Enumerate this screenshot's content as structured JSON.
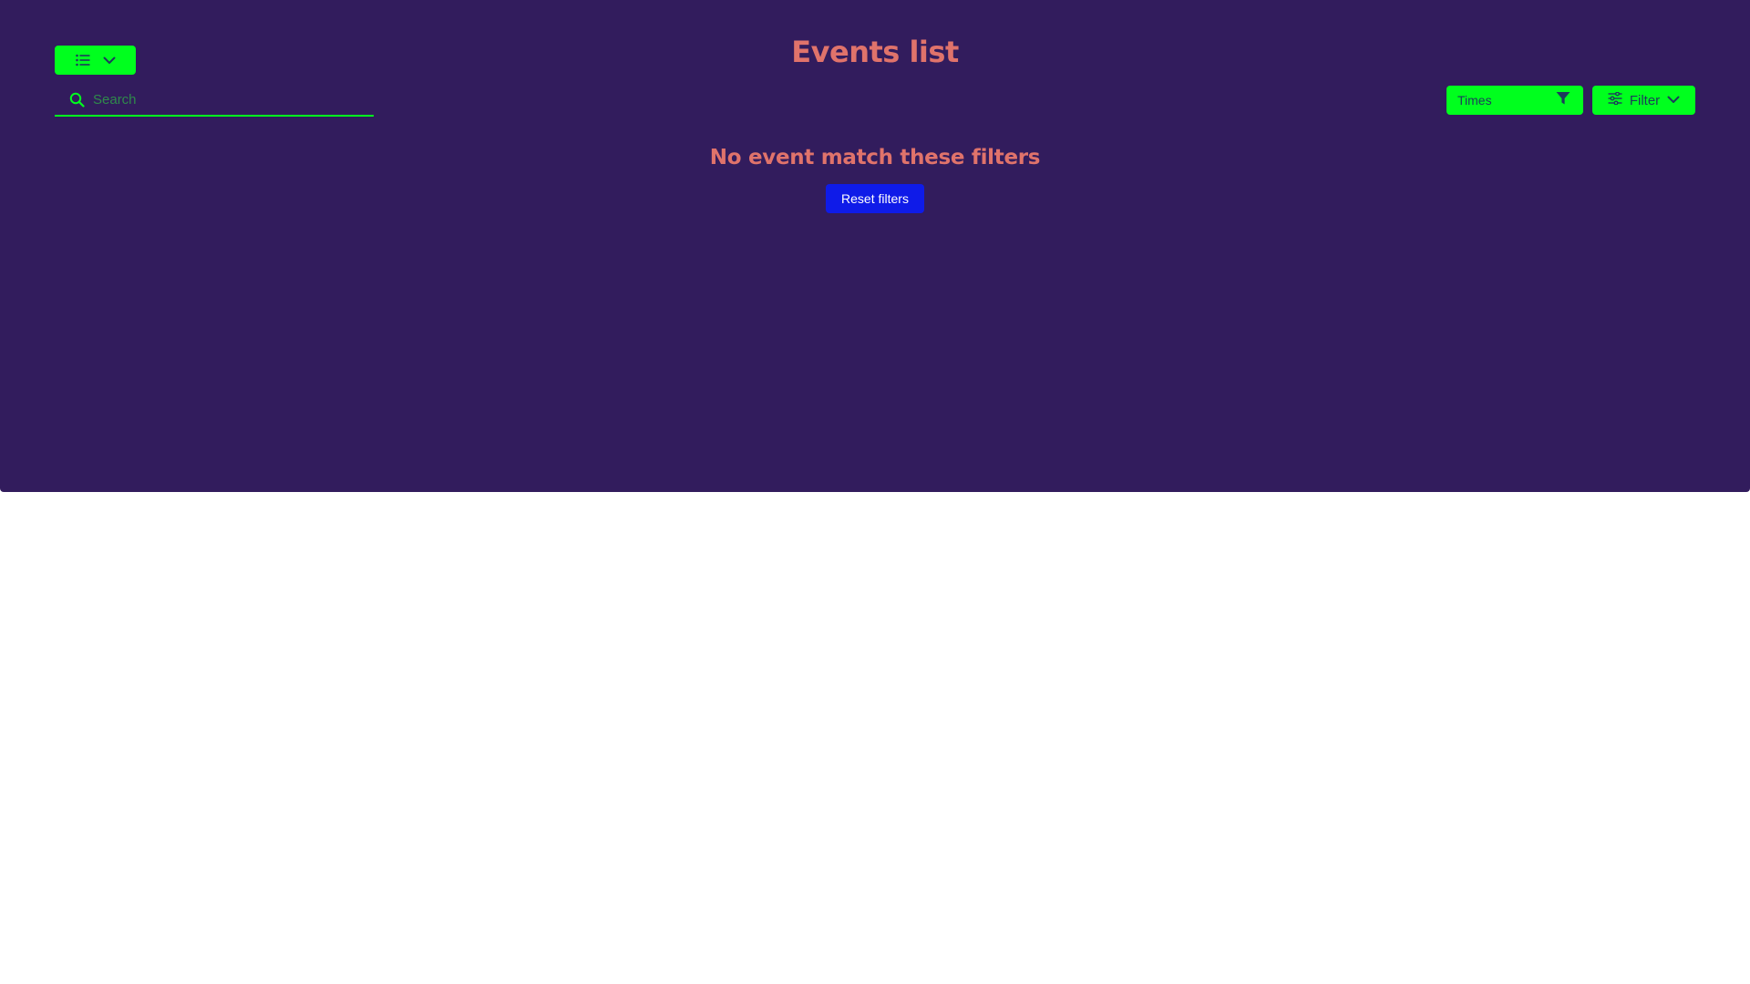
{
  "header": {
    "title": "Events list"
  },
  "search": {
    "placeholder": "Search",
    "value": ""
  },
  "view_toggle": {
    "icon": "list-icon",
    "dropdown_icon": "chevron-down-icon"
  },
  "time_filter": {
    "label": "Times",
    "icon": "funnel-icon"
  },
  "filter_menu": {
    "label": "Filter",
    "icon": "sliders-icon",
    "dropdown_icon": "chevron-down-icon"
  },
  "empty_state": {
    "message": "No event match these filters",
    "reset_label": "Reset filters"
  },
  "colors": {
    "panel_background": "#321c5d",
    "accent_green": "#00ff1e",
    "title_coral": "#e0736b",
    "reset_blue": "#0f1be8",
    "icon_dark": "#1d3a5c"
  }
}
